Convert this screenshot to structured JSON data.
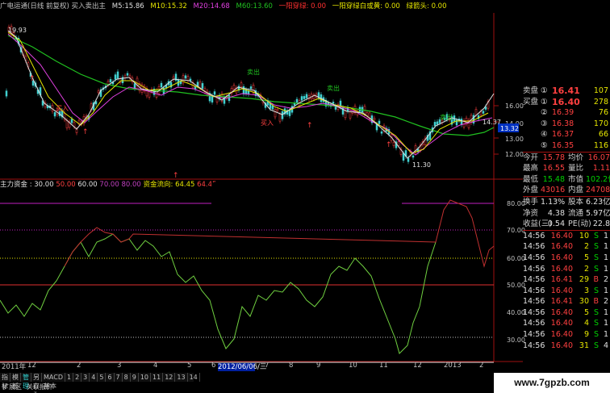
{
  "header": {
    "title": "广电运通(日线 前复权) 买入卖出主",
    "ma5": "M5:15.86",
    "ma10": "M10:15.32",
    "ma20": "M20:14.68",
    "ma60": "M60:13.60",
    "yiyang": "一阳穿绿: 0.00",
    "yiyang2": "一阳穿绿白或黄: 0.00",
    "arrow": "绿箭头: 0.00"
  },
  "price_chart": {
    "high_label": "19.93",
    "low_label": "11.30",
    "last_label": "14.37",
    "current_badge": "13.32",
    "buy_labels": [
      "买入",
      "买入",
      "买入"
    ],
    "sell_labels": [
      "卖出",
      "卖出",
      "卖出"
    ],
    "y_ticks": [
      "16.00",
      "15.00",
      "14.00",
      "13.00",
      "12.00"
    ]
  },
  "sub_header": {
    "title": "主力资金 : 30.00",
    "v50": "50.00",
    "v60": "60.00",
    "v70": "70.00",
    "v80": "80.00",
    "flow": "资金流向: 64.45",
    "flow2": "64.45"
  },
  "sub_chart": {
    "y_ticks": [
      "80.00",
      "70.00",
      "60.00",
      "50.00",
      "40.00",
      "30.00"
    ]
  },
  "date_axis": {
    "labels": [
      "2011年",
      "12",
      "2",
      "3",
      "4",
      "5",
      "6",
      "2012/06/06/三",
      "7",
      "8",
      "9",
      "10",
      "11",
      "12",
      "2013",
      "2"
    ]
  },
  "quote_panel": {
    "sell_label": "卖盘",
    "sell_no": "①",
    "sell_price": "16.41",
    "sell_vol": "107",
    "buy_rows": [
      {
        "label": "买盘",
        "no": "①",
        "price": "16.40",
        "vol": "278"
      },
      {
        "label": "",
        "no": "②",
        "price": "16.39",
        "vol": "76"
      },
      {
        "label": "",
        "no": "③",
        "price": "16.38",
        "vol": "170"
      },
      {
        "label": "",
        "no": "④",
        "price": "16.37",
        "vol": "66"
      },
      {
        "label": "",
        "no": "⑤",
        "price": "16.35",
        "vol": "116"
      }
    ],
    "stats": [
      {
        "k1": "今开",
        "v1": "15.78",
        "k2": "均价",
        "v2": "16.07"
      },
      {
        "k1": "最高",
        "v1": "16.55",
        "k2": "量比",
        "v2": "1.11"
      },
      {
        "k1": "最低",
        "v1": "15.48",
        "k2": "市值",
        "v2": "102.2亿"
      },
      {
        "k1": "外盘",
        "v1": "43016",
        "k2": "内盘",
        "v2": "24708"
      }
    ],
    "stats2": [
      {
        "k1": "换手",
        "v1": "1.13%",
        "k2": "股本",
        "v2": "6.23亿"
      },
      {
        "k1": "净资",
        "v1": "4.38",
        "k2": "流通",
        "v2": "5.97亿"
      },
      {
        "k1": "收益(三)",
        "v1": "0.54",
        "k2": "PE(动)",
        "v2": "22.8"
      }
    ],
    "ticks": [
      {
        "time": "14:56",
        "price": "16.40",
        "vol": "10",
        "side": "S",
        "n": "1"
      },
      {
        "time": "14:56",
        "price": "16.40",
        "vol": "2",
        "side": "S",
        "n": "1"
      },
      {
        "time": "14:56",
        "price": "16.40",
        "vol": "5",
        "side": "S",
        "n": "1"
      },
      {
        "time": "14:56",
        "price": "16.40",
        "vol": "2",
        "side": "S",
        "n": "1"
      },
      {
        "time": "14:56",
        "price": "16.41",
        "vol": "29",
        "side": "B",
        "n": "2"
      },
      {
        "time": "14:56",
        "price": "16.40",
        "vol": "3",
        "side": "S",
        "n": "1"
      },
      {
        "time": "14:56",
        "price": "16.41",
        "vol": "30",
        "side": "B",
        "n": "2"
      },
      {
        "time": "14:56",
        "price": "16.40",
        "vol": "5",
        "side": "S",
        "n": "1"
      },
      {
        "time": "14:56",
        "price": "16.40",
        "vol": "4",
        "side": "S",
        "n": "1"
      },
      {
        "time": "14:56",
        "price": "16.40",
        "vol": "9",
        "side": "S",
        "n": "1"
      },
      {
        "time": "14:56",
        "price": "16.40",
        "vol": "31",
        "side": "S",
        "n": "4"
      }
    ]
  },
  "tabs": [
    "指标",
    "模板",
    "管理",
    "另存为",
    "MACD基本",
    "1",
    "2",
    "3",
    "4",
    "5",
    "6",
    "7",
    "8",
    "9",
    "10",
    "11",
    "12",
    "13",
    "14"
  ],
  "tabs2": [
    "扩展区",
    "关联报价"
  ],
  "watermark": "www.7gpzb.com",
  "colors": {
    "up": "#ff4040",
    "down": "#00d000",
    "ma5": "#e0e0e0",
    "ma10": "#e6e600",
    "ma20": "#e040e0",
    "ma60": "#20c020"
  }
}
